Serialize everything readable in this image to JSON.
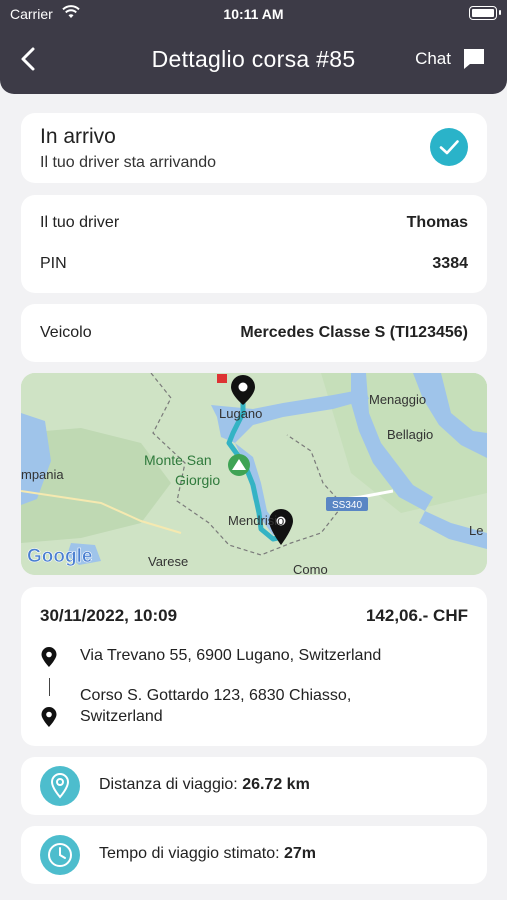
{
  "status_bar": {
    "carrier": "Carrier",
    "time": "10:11 AM"
  },
  "header": {
    "title": "Dettaglio corsa #85",
    "chat_label": "Chat"
  },
  "ride_status": {
    "title": "In arrivo",
    "subtitle": "Il tuo driver sta arrivando"
  },
  "driver": {
    "label": "Il tuo driver",
    "name": "Thomas",
    "pin_label": "PIN",
    "pin": "3384"
  },
  "vehicle": {
    "label": "Veicolo",
    "value": "Mercedes Classe S (TI123456)"
  },
  "map": {
    "labels": {
      "lugano": "Lugano",
      "menaggio": "Menaggio",
      "bellagio": "Bellagio",
      "monte1": "Monte San",
      "monte2": "Giorgio",
      "mendrisio": "Mendrisio",
      "varese": "Varese",
      "como": "Como",
      "road": "SS340",
      "brand": "Google",
      "mpania": "mpania",
      "le": "Le"
    },
    "colors": {
      "water": "#9fc4ea",
      "land": "#cfe3c5",
      "route": "#34b3c4"
    }
  },
  "trip": {
    "datetime": "30/11/2022, 10:09",
    "price": "142,06.- CHF",
    "from": "Via Trevano 55, 6900 Lugano, Switzerland",
    "to_line1": "Corso S. Gottardo 123, 6830 Chiasso,",
    "to_line2": "Switzerland"
  },
  "distance": {
    "label": "Distanza di viaggio: ",
    "value": "26.72 km"
  },
  "duration": {
    "label": "Tempo di viaggio stimato: ",
    "value": "27m"
  },
  "colors": {
    "header_bg": "#3d3b47",
    "accent": "#2ab3c9",
    "page_bg": "#f2f2f4"
  }
}
